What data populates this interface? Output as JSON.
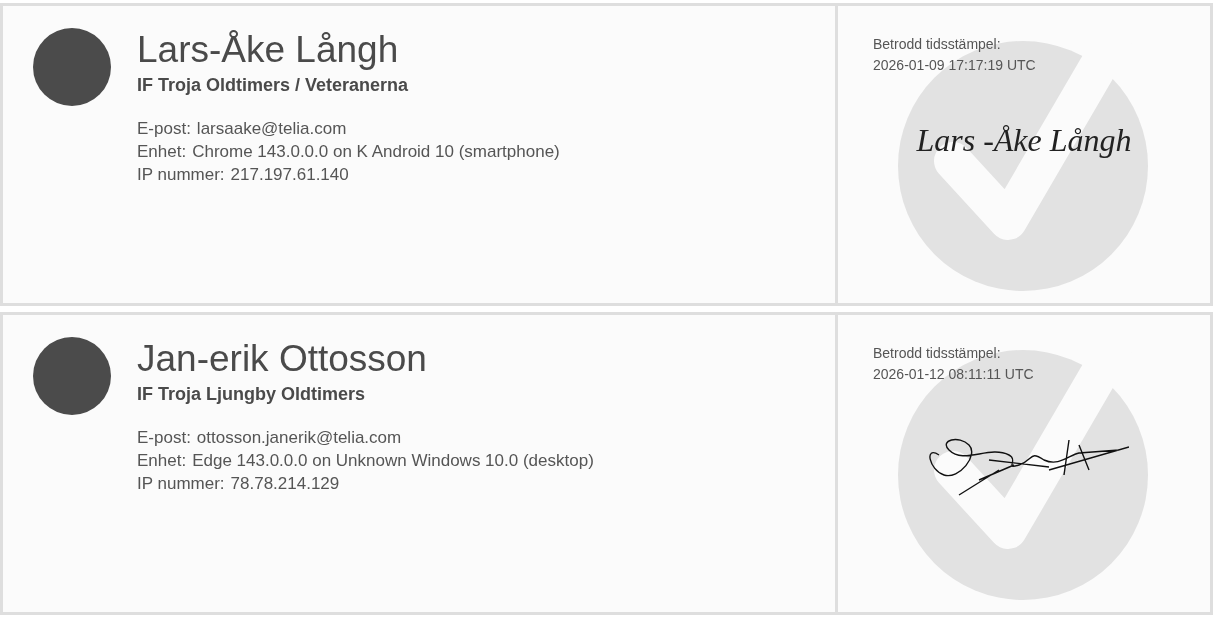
{
  "signers": [
    {
      "name": "Lars-Åke Långh",
      "organization": "IF Troja Oldtimers / Veteranerna",
      "details": [
        {
          "label": "E-post:",
          "value": "larsaake@telia.com"
        },
        {
          "label": "Enhet:",
          "value": "Chrome 143.0.0.0 on K Android 10 (smartphone)"
        },
        {
          "label": "IP nummer:",
          "value": "217.197.61.140"
        }
      ],
      "timestamp_label": "Betrodd tidsstämpel:",
      "timestamp": "2026-01-09 17:17:19 UTC",
      "signature": {
        "kind": "typed",
        "text": "Lars -Åke Långh"
      }
    },
    {
      "name": "Jan-erik Ottosson",
      "organization": "IF Troja Ljungby Oldtimers",
      "details": [
        {
          "label": "E-post:",
          "value": "ottosson.janerik@telia.com"
        },
        {
          "label": "Enhet:",
          "value": "Edge 143.0.0.0 on Unknown Windows 10.0 (desktop)"
        },
        {
          "label": "IP nummer:",
          "value": "78.78.214.129"
        }
      ],
      "timestamp_label": "Betrodd tidsstämpel:",
      "timestamp": "2026-01-12 08:11:11 UTC",
      "signature": {
        "kind": "drawn"
      }
    }
  ]
}
